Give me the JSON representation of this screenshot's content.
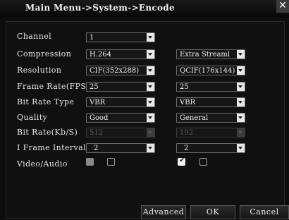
{
  "window": {
    "title": "Main Menu->System->Encode",
    "close_glyph": "✕"
  },
  "rows": {
    "channel": {
      "label": "Channel",
      "value": "1"
    },
    "compression": {
      "label": "Compression",
      "main": "H.264",
      "extra": "Extra Streaml"
    },
    "resolution": {
      "label": "Resolution",
      "main": "CIF(352x288)",
      "extra": "QCIF(176x144)"
    },
    "frame_rate": {
      "label": "Frame Rate(FPS)",
      "main": "25",
      "extra": "25"
    },
    "bit_rate_type": {
      "label": "Bit Rate Type",
      "main": "VBR",
      "extra": "VBR"
    },
    "quality": {
      "label": "Quality",
      "main": "Good",
      "extra": "General"
    },
    "bit_rate": {
      "label": "Bit Rate(Kb/S)",
      "main": "512",
      "extra": "192"
    },
    "i_frame": {
      "label": "I Frame Interval",
      "main": "2",
      "extra": "2"
    },
    "video_audio": {
      "label": "Video/Audio",
      "main_video": true,
      "main_audio": false,
      "extra_video": true,
      "extra_audio": false
    }
  },
  "buttons": {
    "advanced": "Advanced",
    "ok": "OK",
    "cancel": "Cancel"
  }
}
